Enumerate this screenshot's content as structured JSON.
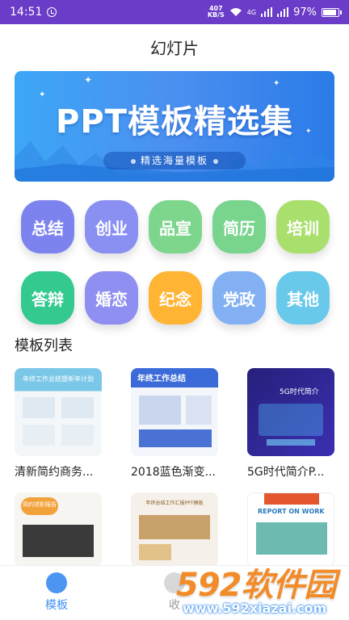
{
  "status_bar": {
    "time": "14:51",
    "net_speed_value": "407",
    "net_speed_unit": "KB/S",
    "network": "4G",
    "battery": "97%",
    "battery_level": 0.97
  },
  "header": {
    "title": "幻灯片"
  },
  "banner": {
    "title": "PPT模板精选集",
    "subtitle": "精选海量模板"
  },
  "categories": [
    {
      "label": "总结",
      "color": "#7d83ee"
    },
    {
      "label": "创业",
      "color": "#8a8ff2"
    },
    {
      "label": "品宣",
      "color": "#7ed68d"
    },
    {
      "label": "简历",
      "color": "#79d48e"
    },
    {
      "label": "培训",
      "color": "#a9df6d"
    },
    {
      "label": "答辩",
      "color": "#33c98f"
    },
    {
      "label": "婚恋",
      "color": "#8f8ef1"
    },
    {
      "label": "纪念",
      "color": "#ffb433"
    },
    {
      "label": "党政",
      "color": "#82b0f3"
    },
    {
      "label": "其他",
      "color": "#69c9ea"
    }
  ],
  "templates_section": {
    "title": "模板列表"
  },
  "templates": [
    {
      "name": "清新简约商务...",
      "headline": "年终工作总结暨新年计划"
    },
    {
      "name": "2018蓝色渐变...",
      "headline": "年终工作总结"
    },
    {
      "name": "5G时代简介P...",
      "headline": "5G时代简介"
    },
    {
      "name": "",
      "headline": "简约述职报告"
    },
    {
      "name": "",
      "headline": "年终总结工作汇报PPT模板"
    },
    {
      "name": "",
      "headline": "REPORT ON WORK"
    }
  ],
  "tabbar": {
    "tabs": [
      {
        "label": "模板",
        "active": true
      },
      {
        "label": "收"
      }
    ]
  },
  "watermark": {
    "brand": "592软件园",
    "url": "www.592xiazai.com"
  }
}
